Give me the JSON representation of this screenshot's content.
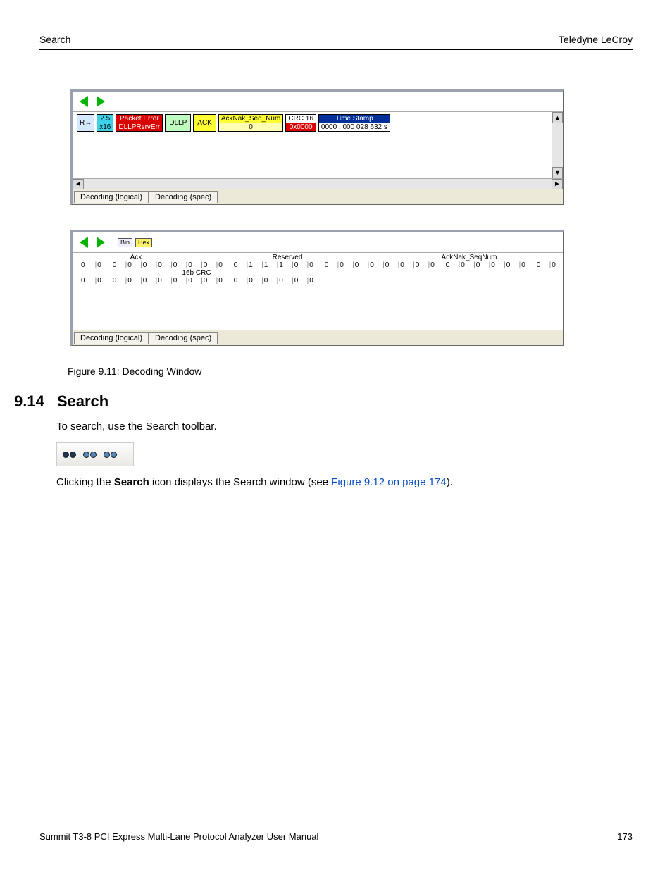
{
  "header": {
    "left": "Search",
    "right": "Teledyne LeCroy"
  },
  "shot1": {
    "tabs": [
      "Decoding (logical)",
      "Decoding (spec)"
    ],
    "packet": {
      "dir": "R→",
      "speed": "2.5",
      "lanes": "x16",
      "err1": "Packet Error",
      "err2": "DLLPRsrvErr",
      "dllp": "DLLP",
      "ack": "ACK",
      "seq_label": "AckNak_Seq_Num",
      "seq_val": "0",
      "crc_label": "CRC 16",
      "crc_val": "0x0000",
      "ts_label": "Time Stamp",
      "ts_val": "0000 . 000 028 632 s"
    }
  },
  "shot2": {
    "toggles": {
      "bin": "Bin",
      "hex": "Hex"
    },
    "headers": [
      "Ack",
      "Reserved",
      "AckNak_SeqNum"
    ],
    "row1": "0 0 0 0 0 0 0 0  0 0 0 1 1 1 0 0  0 0 0 0  0 0 0 0 0 0 0 0 0 0 0 0",
    "crc_label": "16b CRC",
    "row2": "0 0 0 0 0 0 0 0  0 0 0 0 0 0 0 0",
    "tabs": [
      "Decoding (logical)",
      "Decoding (spec)"
    ]
  },
  "caption": "Figure 9.11:  Decoding Window",
  "section": {
    "num": "9.14",
    "title": "Search"
  },
  "para1": "To search, use the Search toolbar.",
  "para2_pre": "Clicking the ",
  "para2_bold": "Search",
  "para2_mid": " icon displays the Search window (see ",
  "para2_link": "Figure 9.12 on page 174",
  "para2_post": ").",
  "footer": {
    "left": "Summit T3-8 PCI Express Multi-Lane Protocol Analyzer User Manual",
    "right": "173"
  }
}
